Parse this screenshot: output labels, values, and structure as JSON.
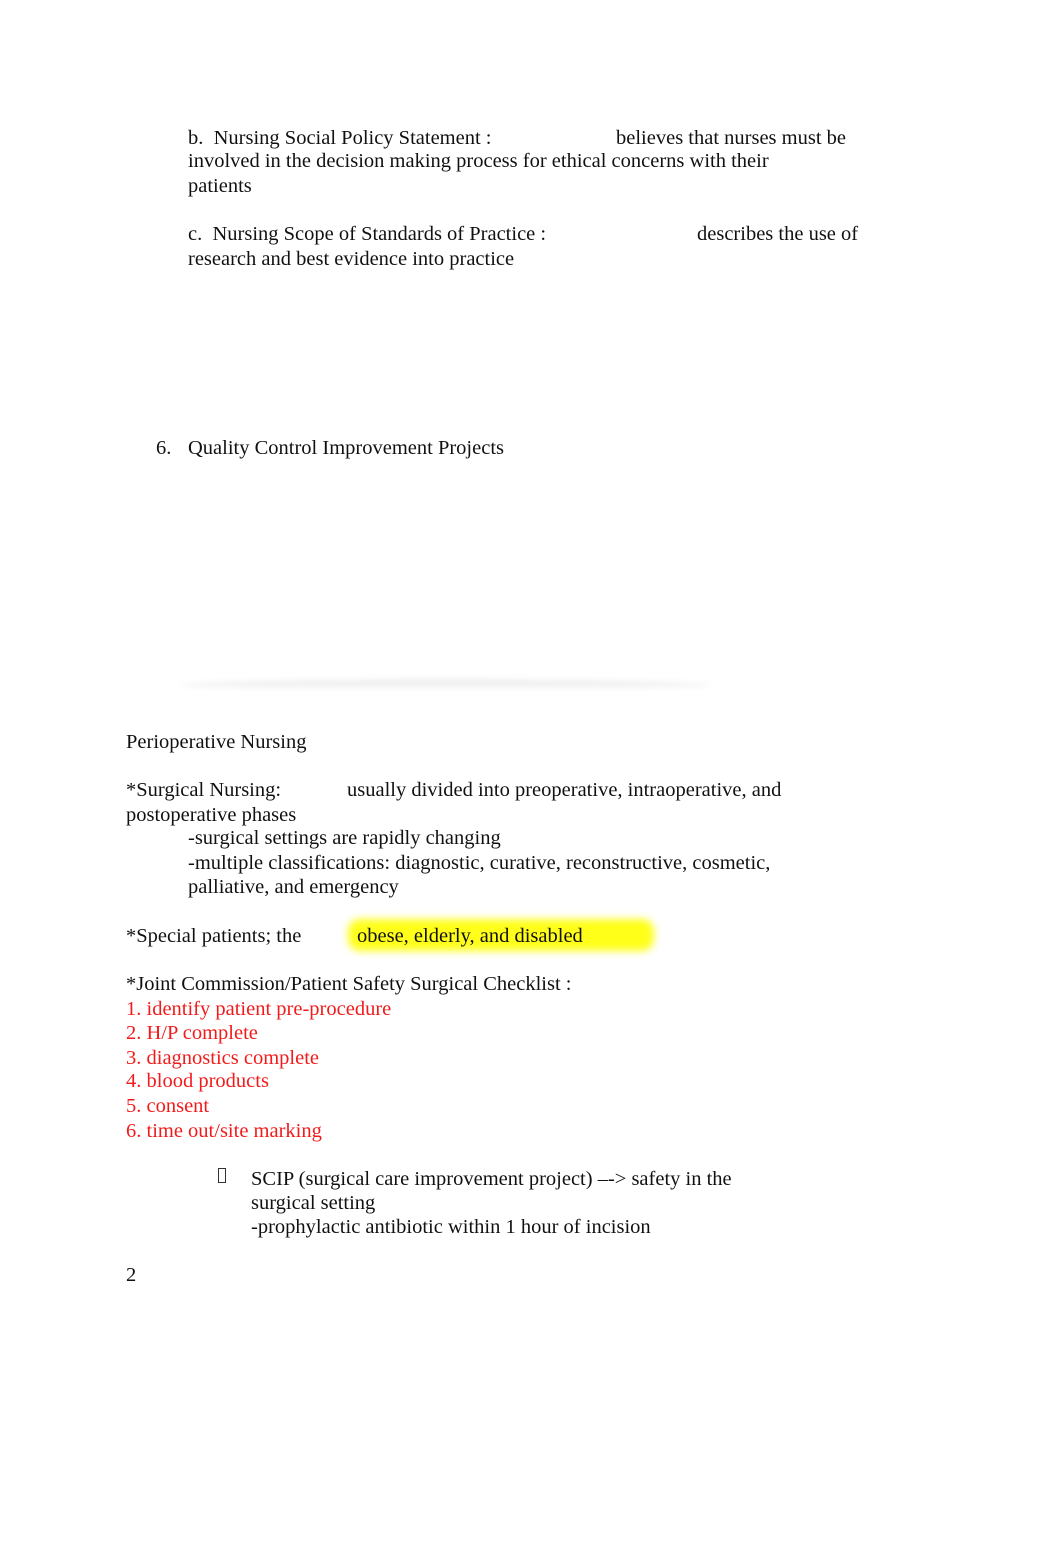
{
  "section_5": {
    "item_b": {
      "label": "b.  Nursing Social Policy Statement :",
      "text_line1": "believes that nurses must be",
      "text_line2": "involved in the decision making process for ethical concerns with their",
      "text_line3": "patients"
    },
    "item_c": {
      "label": "c.  Nursing Scope of Standards of Practice :",
      "text_line1": "describes the use of",
      "text_line2": "research and best evidence into practice"
    }
  },
  "section_6": {
    "number": "6.",
    "title": "Quality Control Improvement Projects"
  },
  "perioperative": {
    "heading": "Perioperative Nursing",
    "surgical_nursing": {
      "label": "*Surgical Nursing:",
      "text_line1": "usually divided into preoperative, intraoperative, and",
      "text_line2": "postoperative phases",
      "sub_items": [
        "-surgical settings are rapidly changing",
        "-multiple classifications: diagnostic, curative, reconstructive, cosmetic,",
        "palliative, and emergency"
      ]
    },
    "special_patients": {
      "label": "*Special patients; the",
      "highlighted_text": "obese, elderly, and disabled",
      "highlight_color": "#ffff1a"
    },
    "checklist": {
      "title": "*Joint Commission/Patient Safety Surgical Checklist :",
      "text_color": "#f21b1b",
      "items": [
        "1. identify patient pre-procedure",
        "2. H/P complete",
        "3. diagnostics complete",
        "4. blood products",
        "5. consent",
        "6. time out/site marking"
      ]
    },
    "scip": {
      "bullet_icon": "missing-glyph-box",
      "line1": "SCIP (surgical care improvement project) –-> safety in the",
      "line2": "surgical setting",
      "line3": "-prophylactic antibiotic within 1 hour of incision"
    }
  },
  "page_number": "2"
}
